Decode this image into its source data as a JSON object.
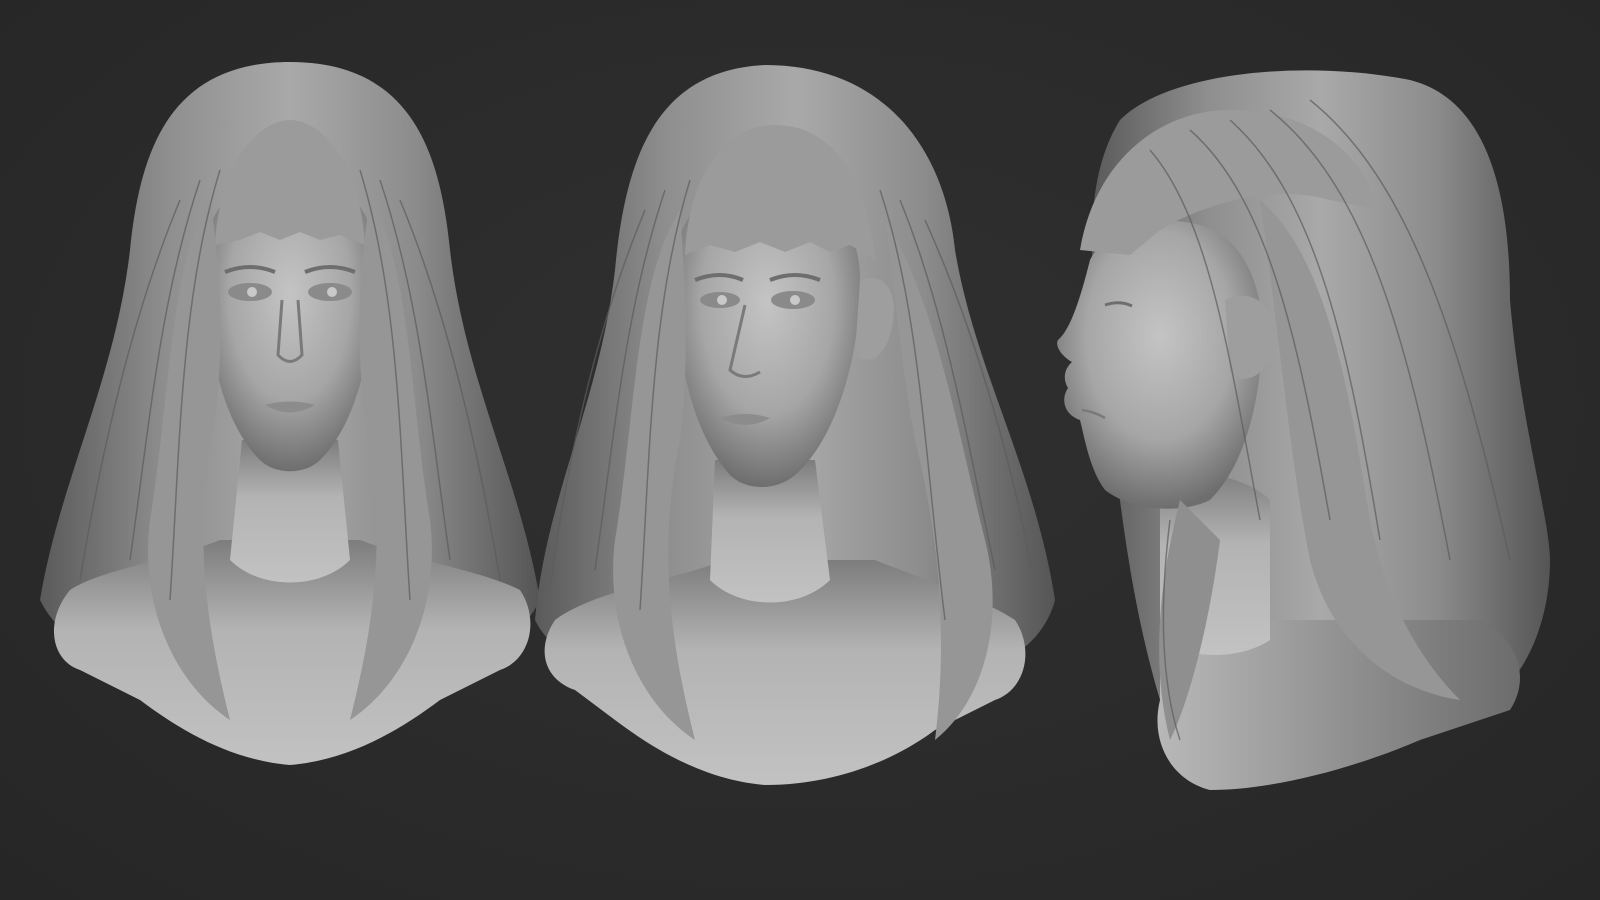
{
  "scene": {
    "background_color": "#2b2b2b",
    "material_color": "#a8a8a8",
    "views": [
      {
        "view": "front"
      },
      {
        "view": "three-quarter"
      },
      {
        "view": "profile"
      }
    ]
  }
}
